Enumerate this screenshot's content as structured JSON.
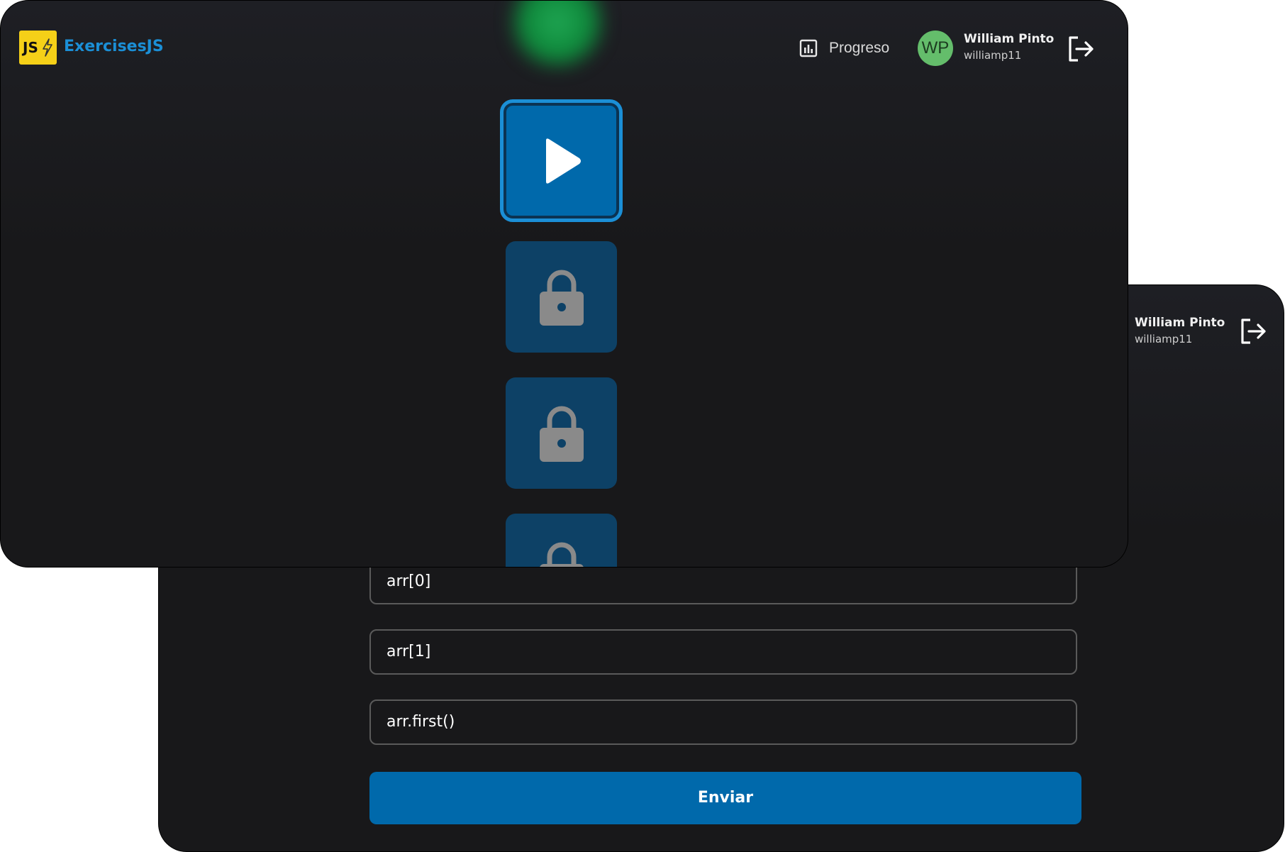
{
  "brand": {
    "logo_text": "JS",
    "name": "ExercisesJS"
  },
  "header": {
    "progress_label": "Progreso"
  },
  "user": {
    "initials": "WP",
    "name": "William Pinto",
    "handle": "williamp11"
  },
  "lessons": [
    {
      "state": "active",
      "icon": "play-icon"
    },
    {
      "state": "locked",
      "icon": "lock-icon"
    },
    {
      "state": "locked",
      "icon": "lock-icon"
    },
    {
      "state": "locked",
      "icon": "lock-icon"
    }
  ],
  "quiz": {
    "options": [
      "arr[0]",
      "arr[1]",
      "arr.first()"
    ],
    "submit_label": "Enviar"
  },
  "colors": {
    "accent": "#0069ab",
    "brand_text": "#1b8fd6",
    "logo_bg": "#f5d018",
    "avatar_bg": "#64bd6b",
    "locked_tile": "#0d4166",
    "background": "#18181a"
  }
}
